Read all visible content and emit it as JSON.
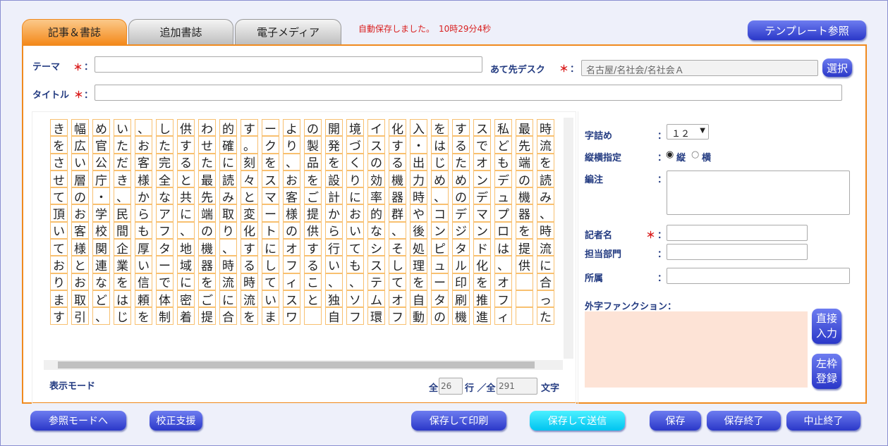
{
  "tabs": [
    "記事＆書誌",
    "追加書誌",
    "電子メディア"
  ],
  "autosave": "自動保存しました。　10時29分4秒",
  "template_btn": "テンプレート参照",
  "theme_label": "テーマ",
  "title_label": "タイトル",
  "required": "＊",
  "colon": "：",
  "desk_label": "あて先デスク",
  "desk_value": "名古屋/名社会/名社会Ａ",
  "select_btn": "選択",
  "display_mode": "表示モード",
  "counter": {
    "prefix": "全",
    "lines": "26",
    "line_unit": "行 ／全",
    "chars": "291",
    "char_unit": "文字"
  },
  "settings": {
    "jizume_label": "字詰め",
    "jizume_value": "１２",
    "orient_label": "縦横指定",
    "vertical": "縦",
    "horizontal": "横",
    "note_label": "編注",
    "reporter_label": "記者名",
    "dept_label": "担当部門",
    "affil_label": "所属",
    "gaiji_label": "外字ファンクション：",
    "direct_btn": "直接\n入力",
    "left_btn": "左枠\n登録"
  },
  "bottom_buttons": {
    "ref": "参照モードへ",
    "proof": "校正支援",
    "print": "保存して印刷",
    "send": "保存して送信",
    "save": "保存",
    "save_end": "保存終了",
    "cancel_end": "中止終了"
  },
  "columns": [
    "時流を読み、時流に合った",
    "最先端の機器を提供　　",
    "私どもデュプロは、オフィ",
    "スでオンデマンド化を推進",
    "するためのデジタル印刷機",
    "をはじめ、コンピュータの",
    "入・出力時や後処理を自動",
    "化する機器群、そしてオフ",
    "イスの効率的なシステム環",
    "境づくりにおいても、ソフト",
    "開発を設計から行い、独自",
    "の製品をご提供すること",
    "より、お客様のオフィスワ",
    "ークをスマートにしていま",
    "す。刻々と変化する時流を",
    "的確に読み取り、時流に合",
    "わせた最先端の機器をご提",
    "供すると共に、地域に密着",
    "した完全なアフターで体制",
    "、お客様からも厚い信頼を",
    "いただき、民間企業をはじ",
    "め官公庁・学校関連など、",
    "幅広い層のお客様とお取引",
    "きをさせて頂いております"
  ]
}
